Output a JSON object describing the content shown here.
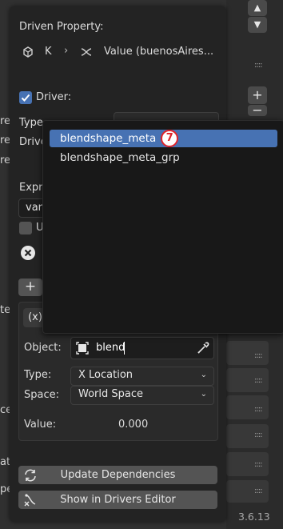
{
  "popover": {
    "title": "Driven Property:",
    "path_object": "K",
    "path_property": "Value (buenosAires...",
    "driver_label": "Driver:",
    "driver_checked": true,
    "type_label": "Type",
    "driver_partial": "Drive",
    "expr_label": "Expr",
    "expr_value": "var",
    "use_partial": "U"
  },
  "variable": {
    "type_icon": "(x)",
    "object_label": "Object:",
    "object_value": "blend",
    "type_label": "Type:",
    "type_value": "X Location",
    "space_label": "Space:",
    "space_value": "World Space",
    "value_label": "Value:",
    "value_value": "0.000"
  },
  "buttons": {
    "update_dependencies": "Update Dependencies",
    "show_in_drivers_editor": "Show in Drivers Editor"
  },
  "dropdown": {
    "items": [
      {
        "label": "blendshape_meta",
        "selected": true,
        "badge": "7"
      },
      {
        "label": "blendshape_meta_grp",
        "selected": false
      }
    ]
  },
  "background": {
    "left_cut": [
      "re",
      "re",
      "re",
      "te",
      "ce",
      "at",
      "pe"
    ],
    "version": "3.6.13"
  },
  "colors": {
    "accent": "#4772b3",
    "badge": "#e0242a",
    "checkbox": "#4772b3"
  }
}
